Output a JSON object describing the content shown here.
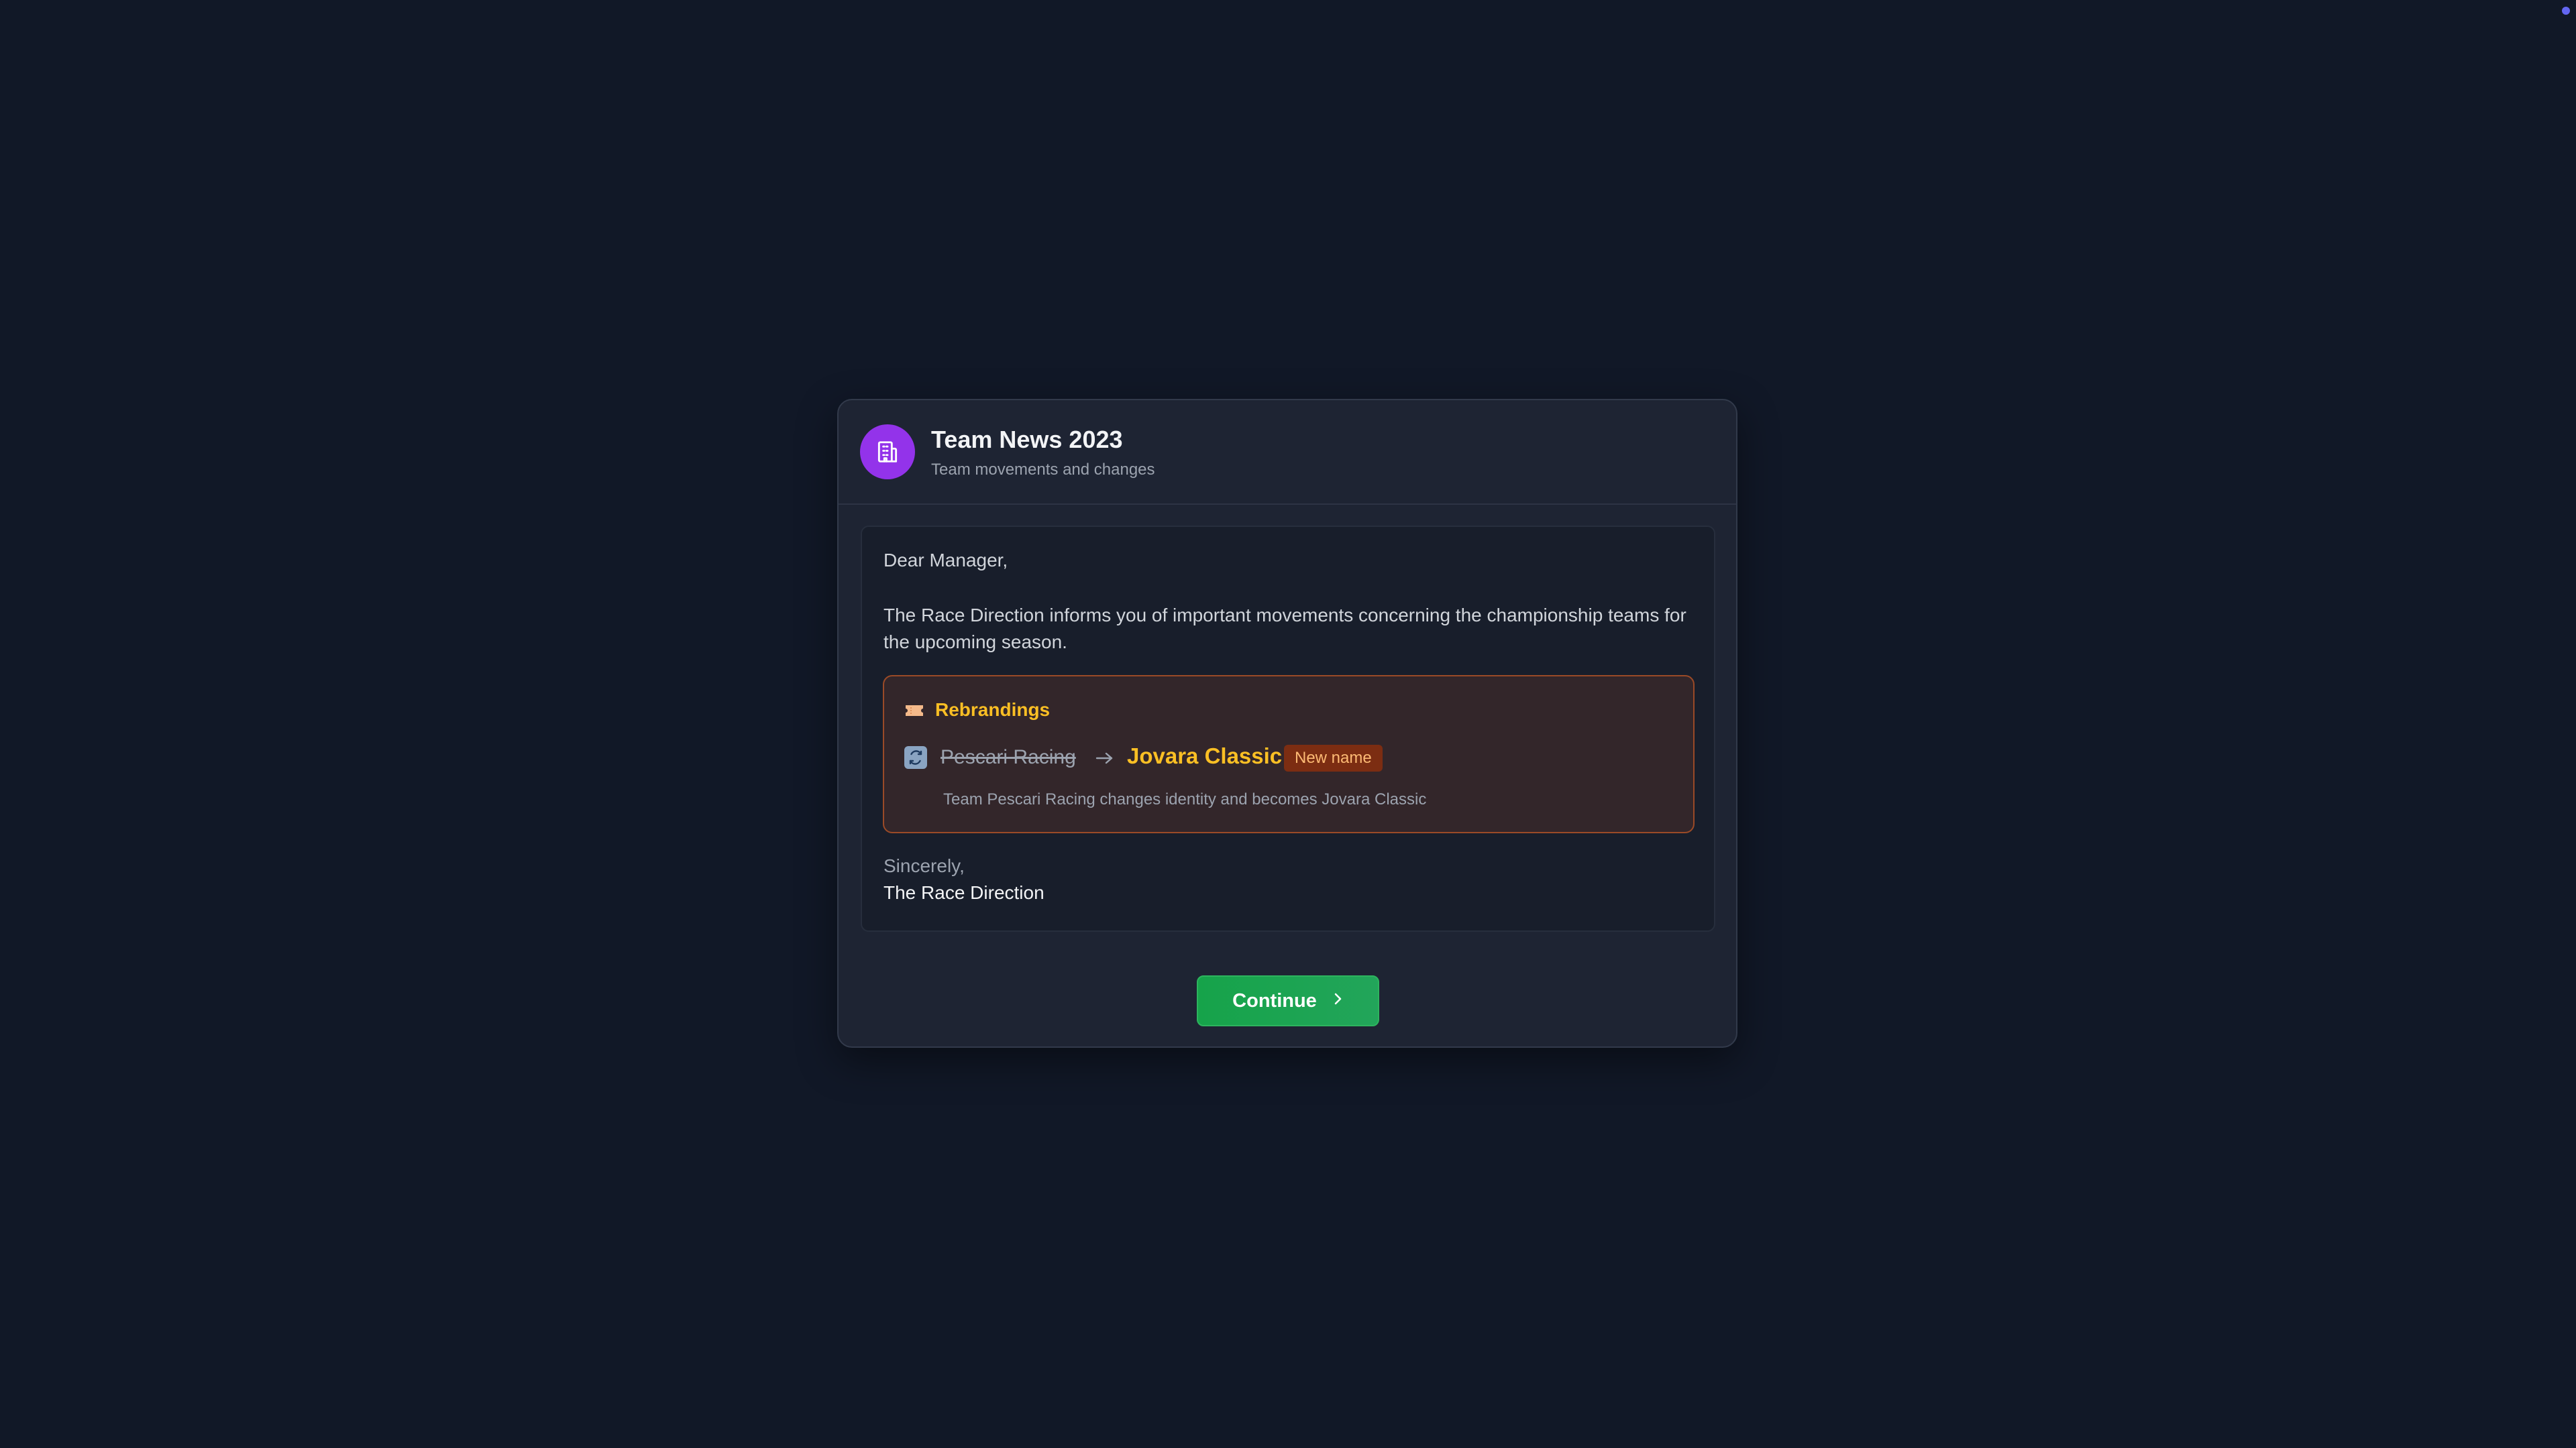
{
  "modal": {
    "title": "Team News 2023",
    "subtitle": "Team movements and changes",
    "icon": "building-icon",
    "accent_color": "#9333ea"
  },
  "letter": {
    "greeting": "Dear Manager,",
    "intro": "The Race Direction informs you of important movements concerning the championship teams for the upcoming season.",
    "rebrandings": {
      "label": "Rebrandings",
      "label_icon": "ticket-icon",
      "items": [
        {
          "icon": "refresh-icon",
          "old_name": "Pescari Racing",
          "new_name": "Jovara Classic",
          "badge": "New name",
          "description": "Team Pescari Racing changes identity and becomes Jovara Classic"
        }
      ]
    },
    "signoff": "Sincerely,",
    "signature": "The Race Direction"
  },
  "actions": {
    "continue_label": "Continue",
    "continue_icon": "chevron-right-icon"
  },
  "colors": {
    "background": "#111827",
    "panel": "#1e2433",
    "highlight": "#fbbf24",
    "rebrand_border": "#9a4a27",
    "button": "#16a34a"
  }
}
